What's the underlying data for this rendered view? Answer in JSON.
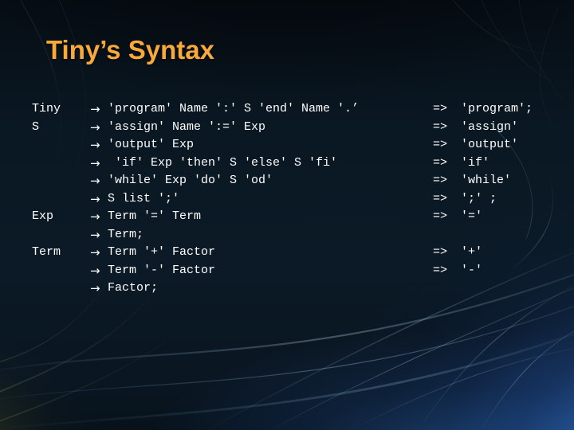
{
  "slide": {
    "title": "Tiny’s Syntax",
    "title_color": "#f9a93a",
    "body_color": "#ffffff",
    "background_color": "#0a1620",
    "accent_glow_color": "#3c7dd2"
  },
  "grammar": {
    "arrow_glyph": "→",
    "implies_glyph": "=>",
    "rules": [
      {
        "lhs": "Tiny",
        "arrow": "→",
        "rhs": "'program' Name ':' S 'end' Name '.’",
        "implies": "=>",
        "token": "'program';"
      },
      {
        "lhs": "S",
        "arrow": "→",
        "rhs": "'assign' Name ':=' Exp",
        "implies": "=>",
        "token": "'assign'"
      },
      {
        "lhs": "",
        "arrow": "→",
        "rhs": "'output' Exp",
        "implies": "=>",
        "token": "'output'"
      },
      {
        "lhs": "",
        "arrow": "→",
        "rhs": " 'if' Exp 'then' S 'else' S 'fi'",
        "implies": "=>",
        "token": "'if'"
      },
      {
        "lhs": "",
        "arrow": "→",
        "rhs": "'while' Exp 'do' S 'od'",
        "implies": "=>",
        "token": "'while'"
      },
      {
        "lhs": "",
        "arrow": "→",
        "rhs": "S list ';'",
        "implies": "=>",
        "token": "';' ;"
      },
      {
        "lhs": "Exp",
        "arrow": "→",
        "rhs": "Term '=' Term",
        "implies": "=>",
        "token": "'='"
      },
      {
        "lhs": "",
        "arrow": "→",
        "rhs": "Term;",
        "implies": "",
        "token": ""
      },
      {
        "lhs": "Term",
        "arrow": "→",
        "rhs": "Term '+' Factor",
        "implies": "=>",
        "token": "'+'"
      },
      {
        "lhs": "",
        "arrow": "→",
        "rhs": "Term '-' Factor",
        "implies": "=>",
        "token": "'-'"
      },
      {
        "lhs": "",
        "arrow": "→",
        "rhs": "Factor;",
        "implies": "",
        "token": ""
      }
    ]
  }
}
